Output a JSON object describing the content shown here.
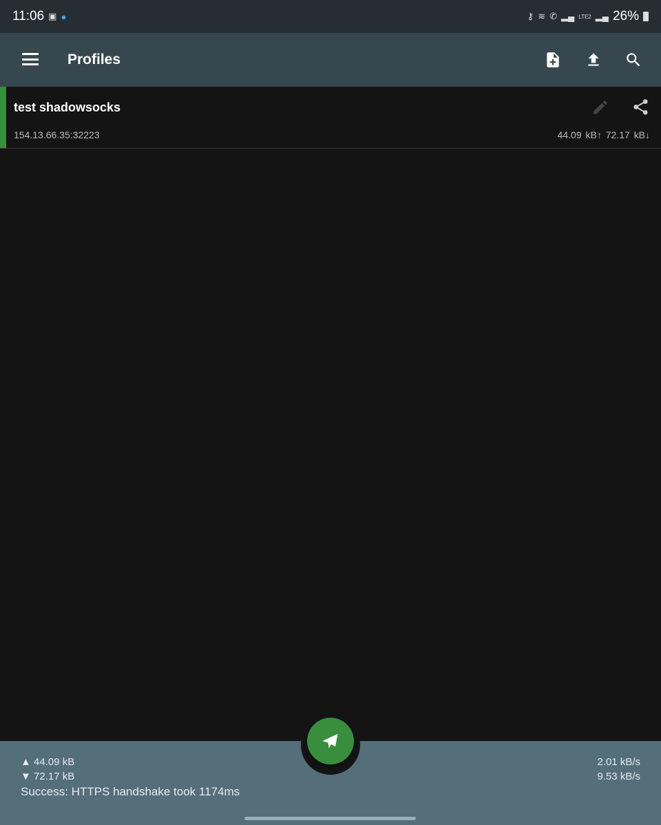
{
  "status_bar": {
    "time": "11:06",
    "battery": "26%",
    "icons": [
      "image-icon",
      "messenger-icon",
      "vpn-key-icon",
      "wifi-icon",
      "call-icon",
      "signal-icon",
      "volte-icon",
      "signal-icon",
      "battery-icon"
    ]
  },
  "app_bar": {
    "title": "Profiles",
    "actions": [
      "add-profile-icon",
      "import-icon",
      "search-icon"
    ]
  },
  "profile": {
    "name": "test shadowsocks",
    "address": "154.13.66.35:32223",
    "traffic": "44.09 kB↑  72.17 kB↓",
    "active_color": "#388e3c"
  },
  "stats": {
    "tx_total": "▲ 44.09 kB",
    "rx_total": "▼ 72.17 kB",
    "tx_rate": "2.01 kB/s",
    "rx_rate": "9.53 kB/s",
    "message": "Success: HTTPS handshake took 1174ms"
  },
  "colors": {
    "app_bar": "#37474f",
    "bottom": "#546e7a",
    "fab": "#388e3c",
    "background": "#141414"
  }
}
